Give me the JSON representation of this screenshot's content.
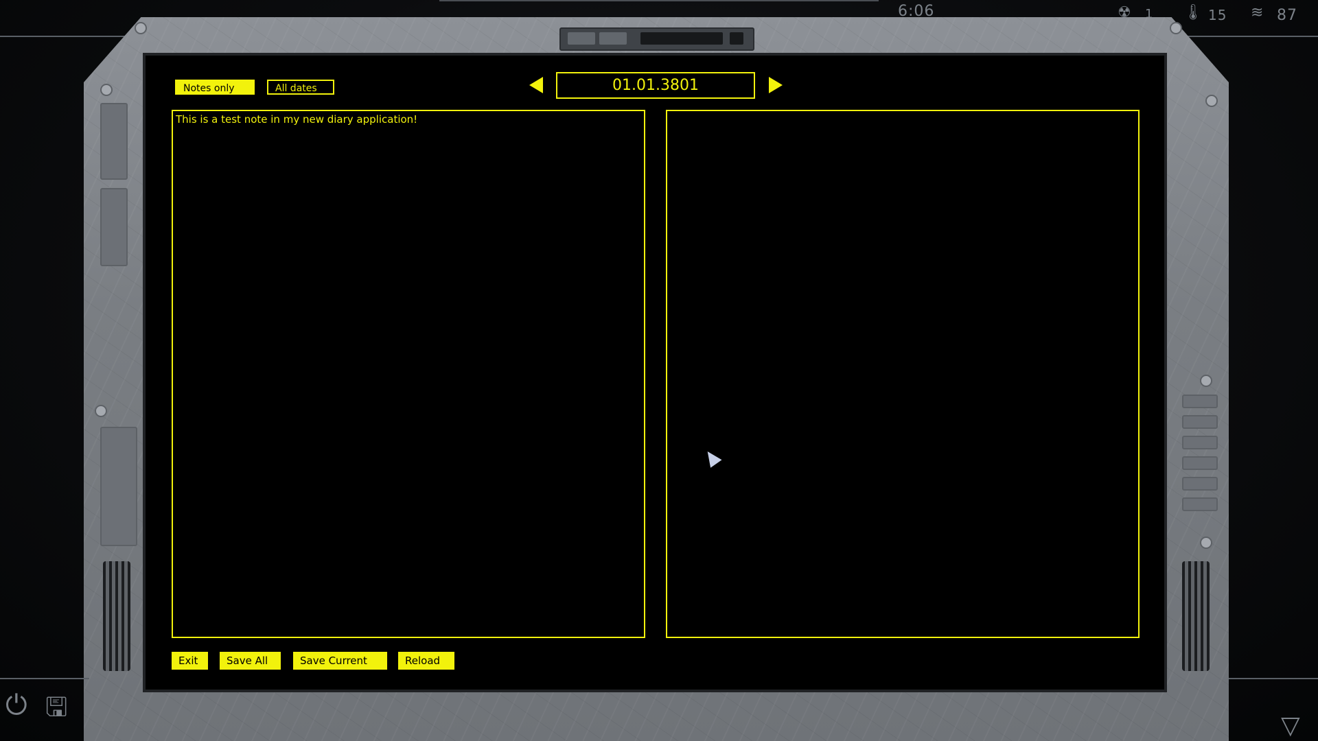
{
  "hud": {
    "time": "6:06",
    "stat1_value": "1",
    "temperature_value": "15",
    "stat3_value": "87"
  },
  "diary": {
    "filters": {
      "notes_only": "Notes only",
      "all_dates": "All dates",
      "active": "notes_only"
    },
    "date": "01.01.3801",
    "note_text": "This is a test note in my new diary application!",
    "right_panel_text": "",
    "buttons": {
      "exit": "Exit",
      "save_all": "Save All",
      "save_current": "Save Current",
      "reload": "Reload"
    }
  },
  "colors": {
    "accent": "#f2f20c",
    "screen": "#000000",
    "frame": "#7f8388",
    "hud_text": "#7c8289"
  },
  "icons": [
    "radiation-icon",
    "thermometer-icon",
    "wind-icon",
    "power-icon",
    "save-icon",
    "chevron-down-icon"
  ]
}
